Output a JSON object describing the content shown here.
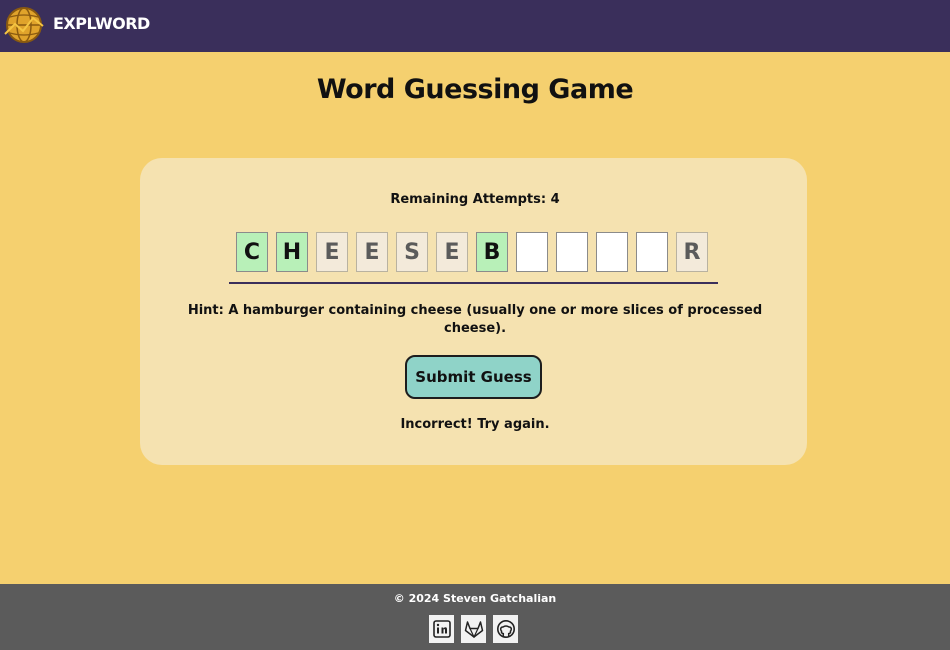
{
  "navbar": {
    "brand": "EXPLWORD",
    "logo_icon": "globe-logo-icon"
  },
  "game": {
    "title": "Word Guessing Game",
    "attempts_text": "Remaining Attempts: 4",
    "tiles": [
      {
        "letter": "C",
        "state": "correct"
      },
      {
        "letter": "H",
        "state": "correct"
      },
      {
        "letter": "E",
        "state": "revealed"
      },
      {
        "letter": "E",
        "state": "revealed"
      },
      {
        "letter": "S",
        "state": "revealed"
      },
      {
        "letter": "E",
        "state": "revealed"
      },
      {
        "letter": "B",
        "state": "correct"
      },
      {
        "letter": "",
        "state": "empty"
      },
      {
        "letter": "",
        "state": "empty"
      },
      {
        "letter": "",
        "state": "empty"
      },
      {
        "letter": "",
        "state": "empty"
      },
      {
        "letter": "R",
        "state": "revealed"
      }
    ],
    "hint": "Hint: A hamburger containing cheese (usually one or more slices of processed cheese).",
    "submit_label": "Submit Guess",
    "feedback": "Incorrect! Try again."
  },
  "footer": {
    "copyright": "© 2024 Steven Gatchalian",
    "social": [
      {
        "name": "linkedin-icon"
      },
      {
        "name": "gitlab-icon"
      },
      {
        "name": "github-icon"
      }
    ]
  },
  "colors": {
    "navbar": "#3a2f5b",
    "background": "#f5d06f",
    "card": "#f5e2b0",
    "correct_tile": "#b8f0b8",
    "button": "#8fd3c8",
    "footer": "#5b5b5b"
  }
}
